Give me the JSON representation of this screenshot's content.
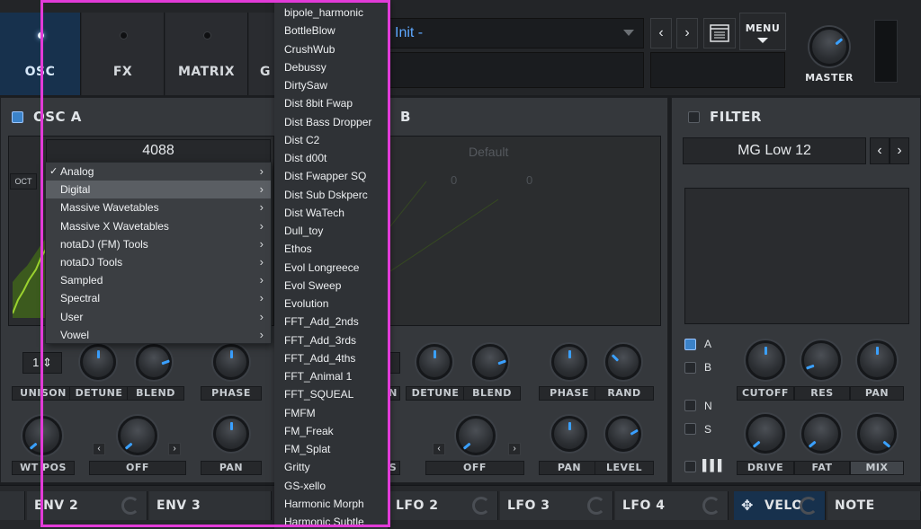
{
  "header": {
    "tabs": [
      {
        "label": "OSC",
        "active": true
      },
      {
        "label": "FX",
        "active": false
      },
      {
        "label": "MATRIX",
        "active": false
      },
      {
        "label": "G",
        "active": false
      }
    ],
    "preset_name": "Init -",
    "prev_symbol": "‹",
    "next_symbol": "›",
    "menu_label": "MENU",
    "master_label": "MASTER"
  },
  "osc_a": {
    "title": "OSC A",
    "wavetable_position": "4088",
    "oct_label": "OCT",
    "unison_value": "1",
    "knob_labels": [
      "UNISON",
      "DETUNE",
      "BLEND",
      "PHASE"
    ],
    "row2_labels": [
      "WT POS",
      "OFF",
      "PAN"
    ]
  },
  "osc_b": {
    "title": "B",
    "wavetable_name": "Default",
    "values": [
      "0",
      "0"
    ],
    "knob_labels": [
      "N",
      "DETUNE",
      "BLEND",
      "PHASE",
      "RAND"
    ],
    "row2_labels": [
      "S",
      "OFF",
      "PAN",
      "LEVEL"
    ]
  },
  "filter": {
    "title": "FILTER",
    "type": "MG Low 12",
    "routing": [
      "A",
      "B",
      "N",
      "S"
    ],
    "knob_labels": [
      "CUTOFF",
      "RES",
      "PAN"
    ],
    "row2_labels": [
      "DRIVE",
      "FAT",
      "MIX"
    ]
  },
  "submenu": {
    "items": [
      {
        "label": "Analog",
        "checked": true
      },
      {
        "label": "Digital",
        "checked": false,
        "highlighted": true
      },
      {
        "label": "Massive Wavetables"
      },
      {
        "label": "Massive X Wavetables"
      },
      {
        "label": "notaDJ (FM) Tools"
      },
      {
        "label": "notaDJ Tools"
      },
      {
        "label": "Sampled"
      },
      {
        "label": "Spectral"
      },
      {
        "label": "User"
      },
      {
        "label": "Vowel"
      }
    ],
    "check_symbol": "✓",
    "arrow_symbol": "›"
  },
  "dropdown": {
    "items": [
      "bipole_harmonic",
      "BottleBlow",
      "CrushWub",
      "Debussy",
      "DirtySaw",
      "Dist 8bit Fwap",
      "Dist Bass Dropper",
      "Dist C2",
      "Dist d00t",
      "Dist Fwapper SQ",
      "Dist Sub Dskperc",
      "Dist WaTech",
      "Dull_toy",
      "Ethos",
      "Evol Longreece",
      "Evol Sweep",
      "Evolution",
      "FFT_Add_2nds",
      "FFT_Add_3rds",
      "FFT_Add_4ths",
      "FFT_Animal 1",
      "FFT_SQUEAL",
      "FMFM",
      "FM_Freak",
      "FM_Splat",
      "Gritty",
      "GS-xello",
      "Harmonic Morph",
      "Harmonic Subtle"
    ]
  },
  "bottom_tabs": [
    {
      "label": "ENV 2"
    },
    {
      "label": "ENV 3"
    },
    {
      "label": "LFO 2"
    },
    {
      "label": "LFO 3"
    },
    {
      "label": "LFO 4"
    },
    {
      "label": "VELO",
      "active": true
    },
    {
      "label": "NOTE"
    }
  ],
  "colors": {
    "accent": "#3aa0ff",
    "highlight_outline": "#e23bd8",
    "active_tab": "#17314d"
  }
}
